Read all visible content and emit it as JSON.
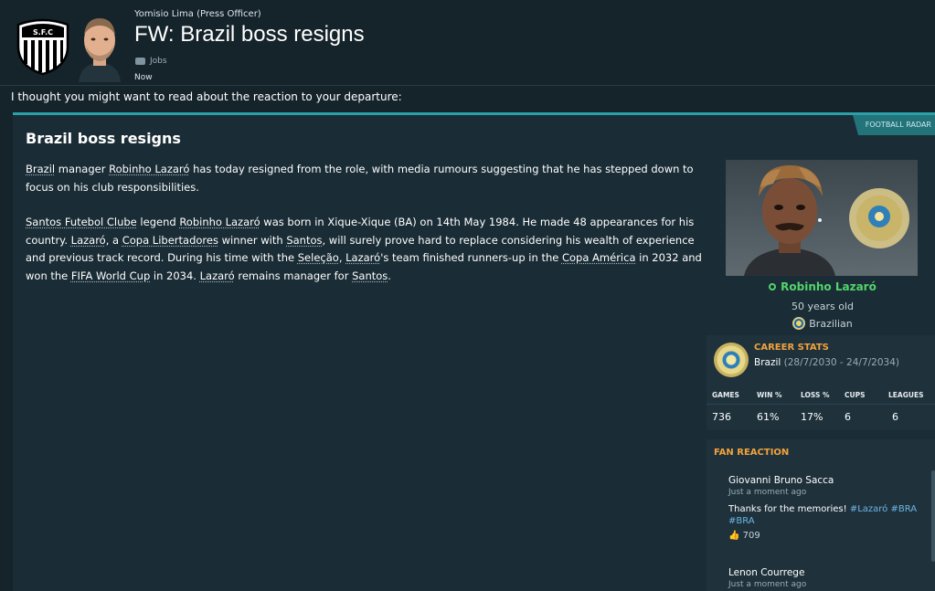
{
  "header": {
    "sender": "Yomisio Lima  (Press Officer)",
    "title": "FW: Brazil boss resigns",
    "tag": "Jobs",
    "time": "Now"
  },
  "intro": "I thought you might want to read about the reaction to your departure:",
  "article": {
    "source": "FOOTBALL RADAR",
    "headline": "Brazil boss resigns",
    "p1": [
      {
        "t": "Brazil",
        "u": true
      },
      {
        "t": " manager "
      },
      {
        "t": "Robinho Lazaró",
        "u": true
      },
      {
        "t": " has today resigned from the role, with media rumours suggesting that he has stepped down to focus on his club responsibilities."
      }
    ],
    "p2": [
      {
        "t": "Santos Futebol Clube",
        "u": true
      },
      {
        "t": " legend "
      },
      {
        "t": "Robinho Lazaró",
        "u": true
      },
      {
        "t": " was born in Xique-Xique (BA) on 14th May 1984. He made 48 appearances for his country. "
      },
      {
        "t": "Lazaró",
        "u": true
      },
      {
        "t": ", a "
      },
      {
        "t": "Copa Libertadores",
        "u": true
      },
      {
        "t": " winner with "
      },
      {
        "t": "Santos",
        "u": true
      },
      {
        "t": ", will surely prove hard to replace considering his wealth of experience and previous track record. During his time with the "
      },
      {
        "t": "Seleção",
        "u": true
      },
      {
        "t": ", "
      },
      {
        "t": "Lazaró",
        "u": true
      },
      {
        "t": "'s team finished runners-up in the "
      },
      {
        "t": "Copa América",
        "u": true
      },
      {
        "t": " in 2032 and won the "
      },
      {
        "t": "FIFA World Cup",
        "u": true
      },
      {
        "t": " in 2034. "
      },
      {
        "t": "Lazaró",
        "u": true
      },
      {
        "t": " remains manager for "
      },
      {
        "t": "Santos",
        "u": true
      },
      {
        "t": "."
      }
    ]
  },
  "person": {
    "name": "Robinho Lazaró",
    "age": "50 years old",
    "nationality": "Brazilian"
  },
  "career": {
    "title": "CAREER STATS",
    "team": "Brazil",
    "dates": " (28/7/2030 - 24/7/2034)",
    "headers": [
      "GAMES",
      "WIN %",
      "LOSS %",
      "CUPS",
      "LEAGUES"
    ],
    "values": [
      "736",
      "61%",
      "17%",
      "6",
      "6"
    ]
  },
  "fan_reaction": {
    "title": "FAN REACTION",
    "posts": [
      {
        "user": "Giovanni Bruno Sacca",
        "when": "Just a moment ago",
        "text": "Thanks for the memories! ",
        "hashtags": "#Lazaró #BRA #BRA",
        "likes": "709"
      },
      {
        "user": "Lenon Courrege",
        "when": "Just a moment ago",
        "text": "",
        "hashtags": "",
        "likes": ""
      }
    ]
  },
  "colors": {
    "background": "#15232b",
    "card": "#1a2c35",
    "accent_teal": "#2aa0a8",
    "name_green": "#53d36b",
    "section_orange": "#f2a23c",
    "hashtag_blue": "#6cb6e6"
  }
}
